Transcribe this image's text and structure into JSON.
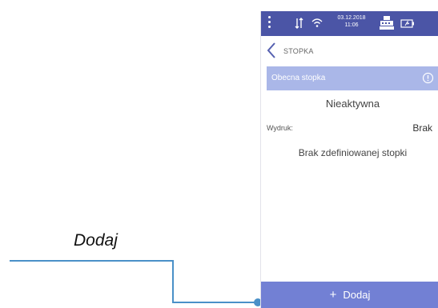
{
  "callout": {
    "label": "Dodaj"
  },
  "status_bar": {
    "date": "03.12.2018",
    "time": "11:06",
    "icons": [
      "menu-dots-icon",
      "data-transfer-icon",
      "wifi-icon",
      "cash-register-icon",
      "battery-icon"
    ]
  },
  "header": {
    "title": "STOPKA",
    "back_icon": "chevron-left-icon"
  },
  "section": {
    "label": "Obecna stopka",
    "info_icon": "info-icon"
  },
  "footer_state": {
    "status": "Nieaktywna",
    "print_label": "Wydruk:",
    "print_value": "Brak",
    "message": "Brak zdefiniowanej stopki"
  },
  "add_button": {
    "icon": "+",
    "label": "Dodaj"
  },
  "colors": {
    "status_bar": "#4b55a6",
    "section_header": "#aab7e8",
    "add_button": "#7280d4",
    "callout_line": "#4a90c8"
  }
}
